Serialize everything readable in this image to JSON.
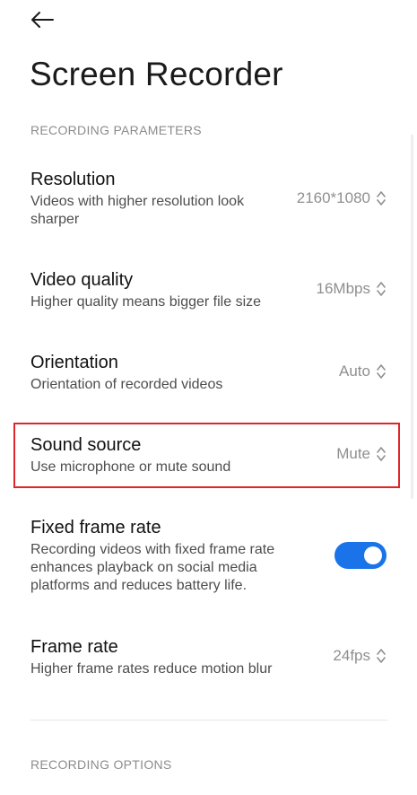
{
  "header": {
    "back_icon": "arrow-left-icon",
    "title": "Screen Recorder"
  },
  "sections": {
    "recording_parameters": "RECORDING PARAMETERS",
    "recording_options": "RECORDING OPTIONS"
  },
  "settings": {
    "resolution": {
      "title": "Resolution",
      "subtitle": "Videos with higher resolution look sharper",
      "value": "2160*1080"
    },
    "video_quality": {
      "title": "Video quality",
      "subtitle": "Higher quality means bigger file size",
      "value": "16Mbps"
    },
    "orientation": {
      "title": "Orientation",
      "subtitle": "Orientation of recorded videos",
      "value": "Auto"
    },
    "sound_source": {
      "title": "Sound source",
      "subtitle": "Use microphone or mute sound",
      "value": "Mute"
    },
    "fixed_frame_rate": {
      "title": "Fixed frame rate",
      "subtitle": "Recording videos with fixed frame rate enhances playback on social media platforms and reduces battery life.",
      "enabled": true
    },
    "frame_rate": {
      "title": "Frame rate",
      "subtitle": "Higher frame rates reduce motion blur",
      "value": "24fps"
    }
  },
  "colors": {
    "accent": "#1a73e8",
    "highlight_border": "#e0252b",
    "secondary_text": "#8f8f8f"
  },
  "icons": {
    "selector": "chevron-up-down-icon",
    "back": "arrow-left-icon"
  }
}
